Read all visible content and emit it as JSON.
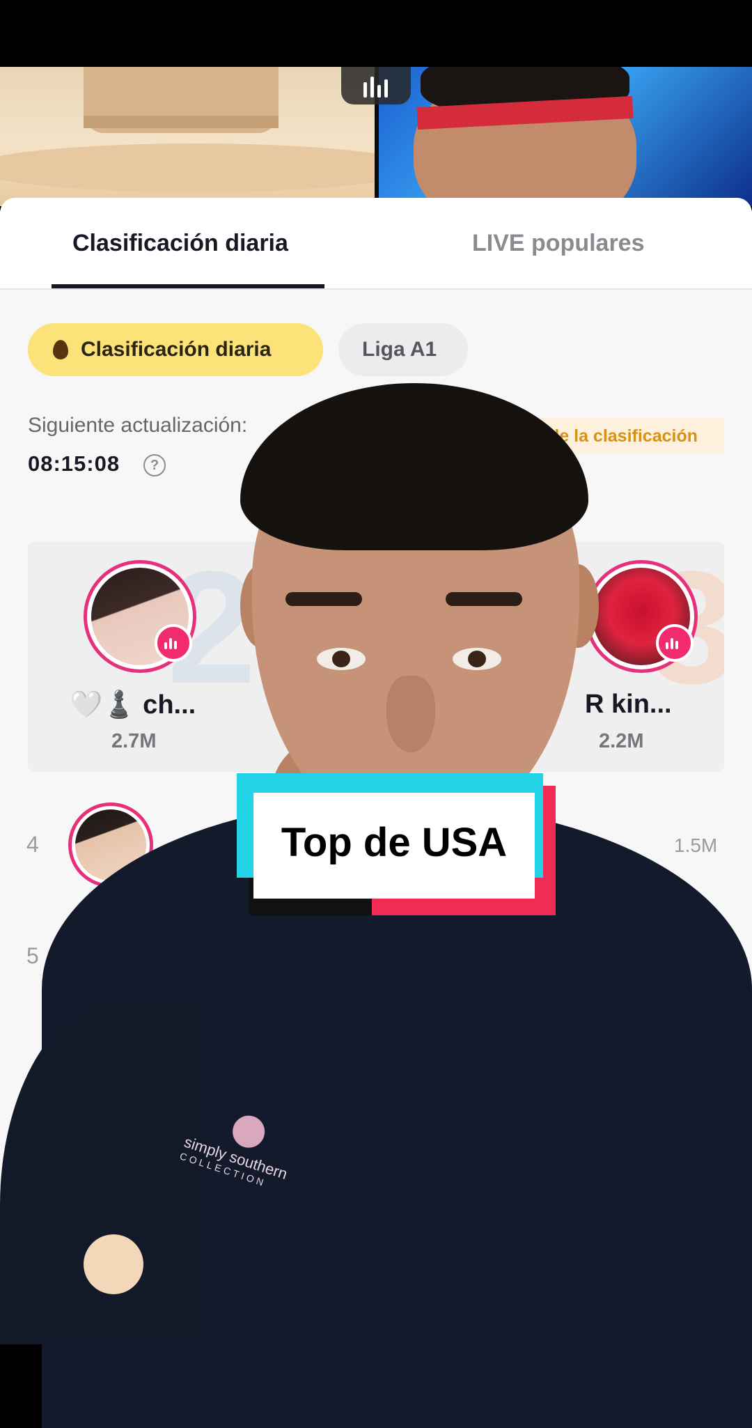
{
  "tabs": {
    "active": "Clasificación diaria",
    "inactive": "LIVE populares"
  },
  "filters": {
    "active": "Clasificación diaria",
    "inactive": "Liga A1"
  },
  "update": {
    "label": "Siguiente actualización:",
    "time": "08:15:08",
    "help": "?"
  },
  "rules_link": "de la clasificación",
  "podium": [
    {
      "rank": "2",
      "name": "🤍♟️ ch...",
      "score": "2.7M"
    },
    {
      "rank": "3",
      "name": "R kin...",
      "score": "2.2M"
    }
  ],
  "list": [
    {
      "rank": "4",
      "score": "1.5M"
    },
    {
      "rank": "5"
    }
  ],
  "caption": "Top de USA",
  "shirt_logo": {
    "line1": "simply southern",
    "line2": "COLLECTION"
  },
  "colors": {
    "accent_pink": "#f22a6e",
    "chip_yellow": "#fbe37a",
    "caption_cyan": "#23d3e8",
    "caption_red": "#f02c56"
  }
}
